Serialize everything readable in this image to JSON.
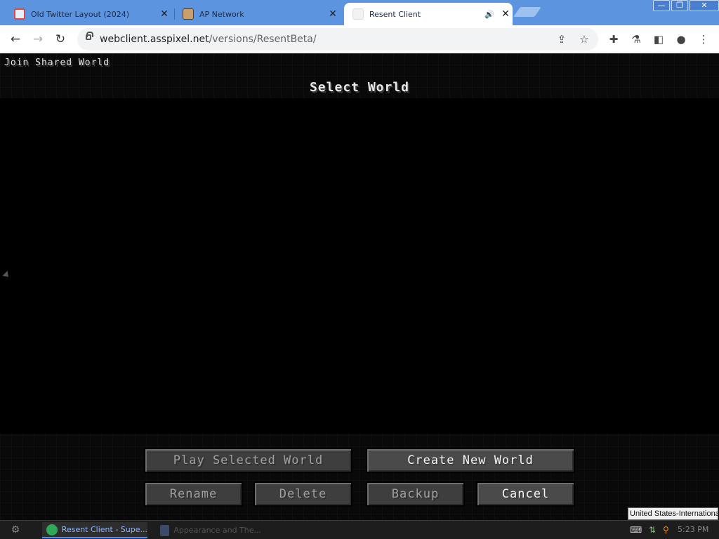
{
  "browser": {
    "tabs": [
      {
        "title": "Old Twitter Layout (2024)",
        "favicon": "old-twitter-favicon",
        "active": false
      },
      {
        "title": "AP Network",
        "favicon": "ap-network-favicon",
        "active": false
      },
      {
        "title": "Resent Client",
        "favicon": "resent-favicon",
        "active": true,
        "audio": true
      }
    ],
    "url": {
      "host": "webclient.asspixel.net",
      "path": "/versions/ResentBeta/"
    },
    "window_controls": [
      "minimize",
      "restore",
      "close"
    ]
  },
  "game": {
    "join_shared_label": "Join Shared World",
    "title": "Select World",
    "buttons": {
      "play_selected": {
        "label": "Play Selected World",
        "enabled": false
      },
      "create_new": {
        "label": "Create New World",
        "enabled": true
      },
      "rename": {
        "label": "Rename",
        "enabled": false
      },
      "delete": {
        "label": "Delete",
        "enabled": false
      },
      "backup": {
        "label": "Backup",
        "enabled": false
      },
      "cancel": {
        "label": "Cancel",
        "enabled": true
      }
    }
  },
  "taskbar": {
    "tasks": [
      {
        "label": "Resent Client - Supe...",
        "active": true
      },
      {
        "label": "Appearance and The...",
        "active": false
      }
    ],
    "tooltip": "United States-International",
    "clock": "5:23 PM"
  },
  "colors": {
    "titlebar": "#5d94e0",
    "game_bg": "#000000",
    "button": "#4a4a4a",
    "taskbar": "#1d1d1d"
  }
}
